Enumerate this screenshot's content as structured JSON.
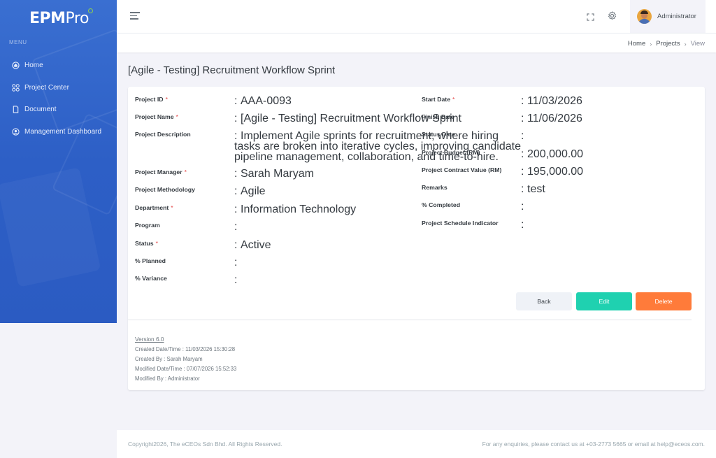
{
  "brand": {
    "name_bold": "EPM",
    "name_light": "Pro"
  },
  "sidebar": {
    "menu_title": "MENU",
    "items": [
      {
        "label": "Home",
        "icon": "home-icon"
      },
      {
        "label": "Project Center",
        "icon": "grid-icon"
      },
      {
        "label": "Document",
        "icon": "document-icon"
      },
      {
        "label": "Management Dashboard",
        "icon": "user-circle-icon"
      }
    ]
  },
  "header": {
    "user_name": "Administrator"
  },
  "breadcrumb": {
    "home": "Home",
    "projects": "Projects",
    "current": "View"
  },
  "page": {
    "title": "[Agile - Testing] Recruitment Workflow Sprint"
  },
  "left_fields": [
    {
      "label": "Project ID",
      "required": "*",
      "value": "AAA-0093"
    },
    {
      "label": "Project Name",
      "required": "*",
      "value": "[Agile - Testing] Recruitment Workflow Sprint"
    },
    {
      "label": "Project Description",
      "required": "",
      "value_lines": [
        "Implement Agile sprints for recruitment, where hiring",
        "tasks are broken into iterative cycles, improving candidate",
        "pipeline management, collaboration, and time-to-hire."
      ]
    },
    {
      "label": "Project Manager",
      "required": "*",
      "value": "Sarah Maryam"
    },
    {
      "label": "Project Methodology",
      "required": "",
      "value": "Agile"
    },
    {
      "label": "Department",
      "required": "*",
      "value": "Information Technology"
    },
    {
      "label": "Program",
      "required": "",
      "value": ""
    },
    {
      "label": "Status",
      "required": "*",
      "value": "Active"
    },
    {
      "label": "% Planned",
      "required": "",
      "value": ""
    },
    {
      "label": "% Variance",
      "required": "",
      "value": ""
    }
  ],
  "right_fields": [
    {
      "label": "Start Date",
      "required": "*",
      "value": "11/03/2026"
    },
    {
      "label": "Finish Date",
      "required": "",
      "value": "11/06/2026"
    },
    {
      "label": "Status Date",
      "required": "",
      "value": ""
    },
    {
      "label": "Project Budget (RM)",
      "required": "",
      "value": "200,000.00"
    },
    {
      "label": "Project Contract Value (RM)",
      "required": "",
      "value": "195,000.00"
    },
    {
      "label": "Remarks",
      "required": "",
      "value": "test"
    },
    {
      "label": "% Completed",
      "required": "",
      "value": ""
    },
    {
      "label": "Project Schedule Indicator",
      "required": "",
      "value": ""
    }
  ],
  "colon": ":",
  "actions": {
    "back": "Back",
    "edit": "Edit",
    "delete": "Delete"
  },
  "meta": {
    "version": "Version 6.0",
    "created_date": "Created Date/Time : 11/03/2026 15:30:28",
    "created_by": "Created By : Sarah Maryam",
    "modified_date": "Modified Date/Time : 07/07/2026 15:52:33",
    "modified_by": "Modified By : Administrator"
  },
  "footer": {
    "copyright": "Copyright2026, The eCEOs Sdn Bhd. All Rights Reserved.",
    "contact": "For any enquiries, please contact us at +03-2773 5665 or email at help@eceos.com."
  },
  "colors": {
    "sidebar": "#2d5fc6",
    "edit": "#1fd1b0",
    "delete": "#ff7b3a",
    "required": "#e34343"
  }
}
